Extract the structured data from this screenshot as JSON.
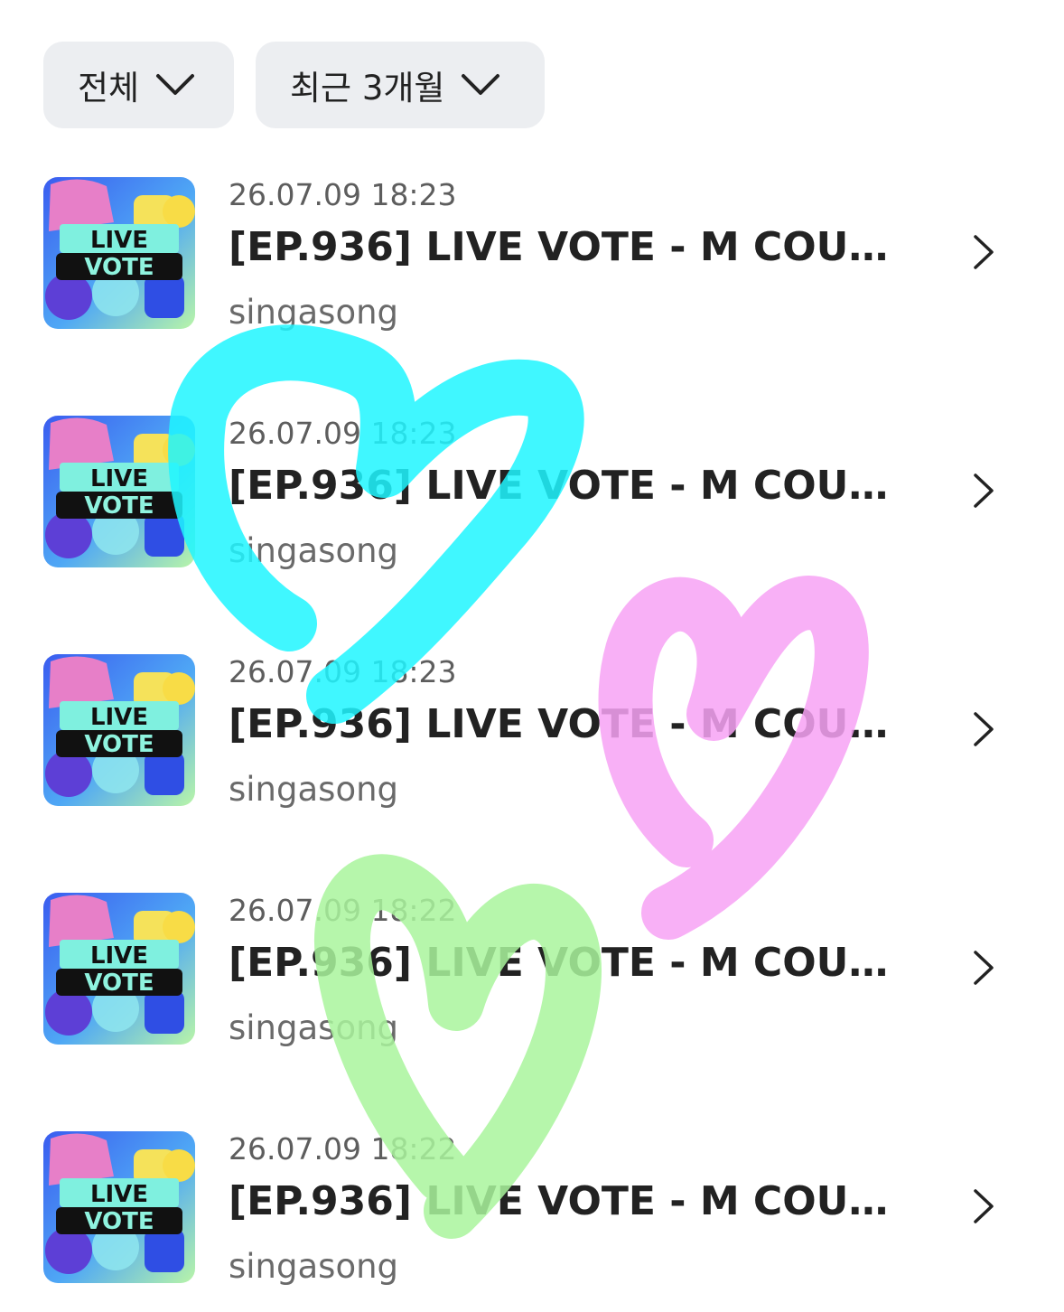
{
  "filters": {
    "all_label": "전체",
    "period_label": "최근 3개월"
  },
  "thumbnail": {
    "line1": "LIVE",
    "line2": "VOTE"
  },
  "items": [
    {
      "date": "26.07.09 18:23",
      "title": "[EP.936] LIVE VOTE - M COUNT...",
      "artist": "singasong"
    },
    {
      "date": "26.07.09 18:23",
      "title": "[EP.936] LIVE VOTE - M COUNT...",
      "artist": "singasong"
    },
    {
      "date": "26.07.09 18:23",
      "title": "[EP.936] LIVE VOTE - M COUNT...",
      "artist": "singasong"
    },
    {
      "date": "26.07.09 18:22",
      "title": "[EP.936] LIVE VOTE - M COUNT...",
      "artist": "singasong"
    },
    {
      "date": "26.07.09 18:22",
      "title": "[EP.936] LIVE VOTE - M COUNT...",
      "artist": "singasong"
    }
  ],
  "doodles": {
    "cyan": "#1ff6ff",
    "pink": "#f7a2f5",
    "green": "#a9f59c"
  }
}
